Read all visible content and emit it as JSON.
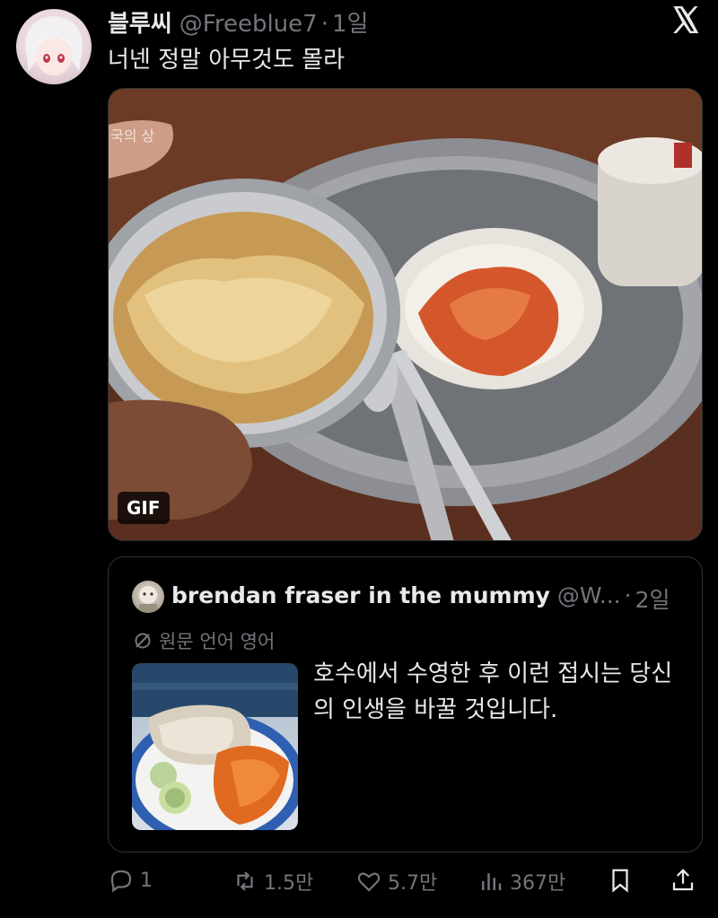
{
  "post": {
    "author_name": "블루씨",
    "author_handle": "@Freeblue7",
    "separator": "·",
    "time": "1일",
    "text": "너넨 정말 아무것도 몰라"
  },
  "media": {
    "badge": "GIF"
  },
  "quote": {
    "author_name": "brendan fraser in the mummy",
    "author_handle": "@W...",
    "separator": "·",
    "time": "2일",
    "translate_label": "원문 언어 영어",
    "text": "호수에서 수영한 후 이런 접시는 당신의 인생을 바꿀 것입니다."
  },
  "actions": {
    "replies": "1",
    "reposts": "1.5만",
    "likes": "5.7만",
    "views": "367만"
  },
  "icons": [
    "x-logo-icon",
    "reply-icon",
    "repost-icon",
    "like-icon",
    "views-icon",
    "bookmark-icon",
    "share-icon",
    "translate-icon"
  ]
}
